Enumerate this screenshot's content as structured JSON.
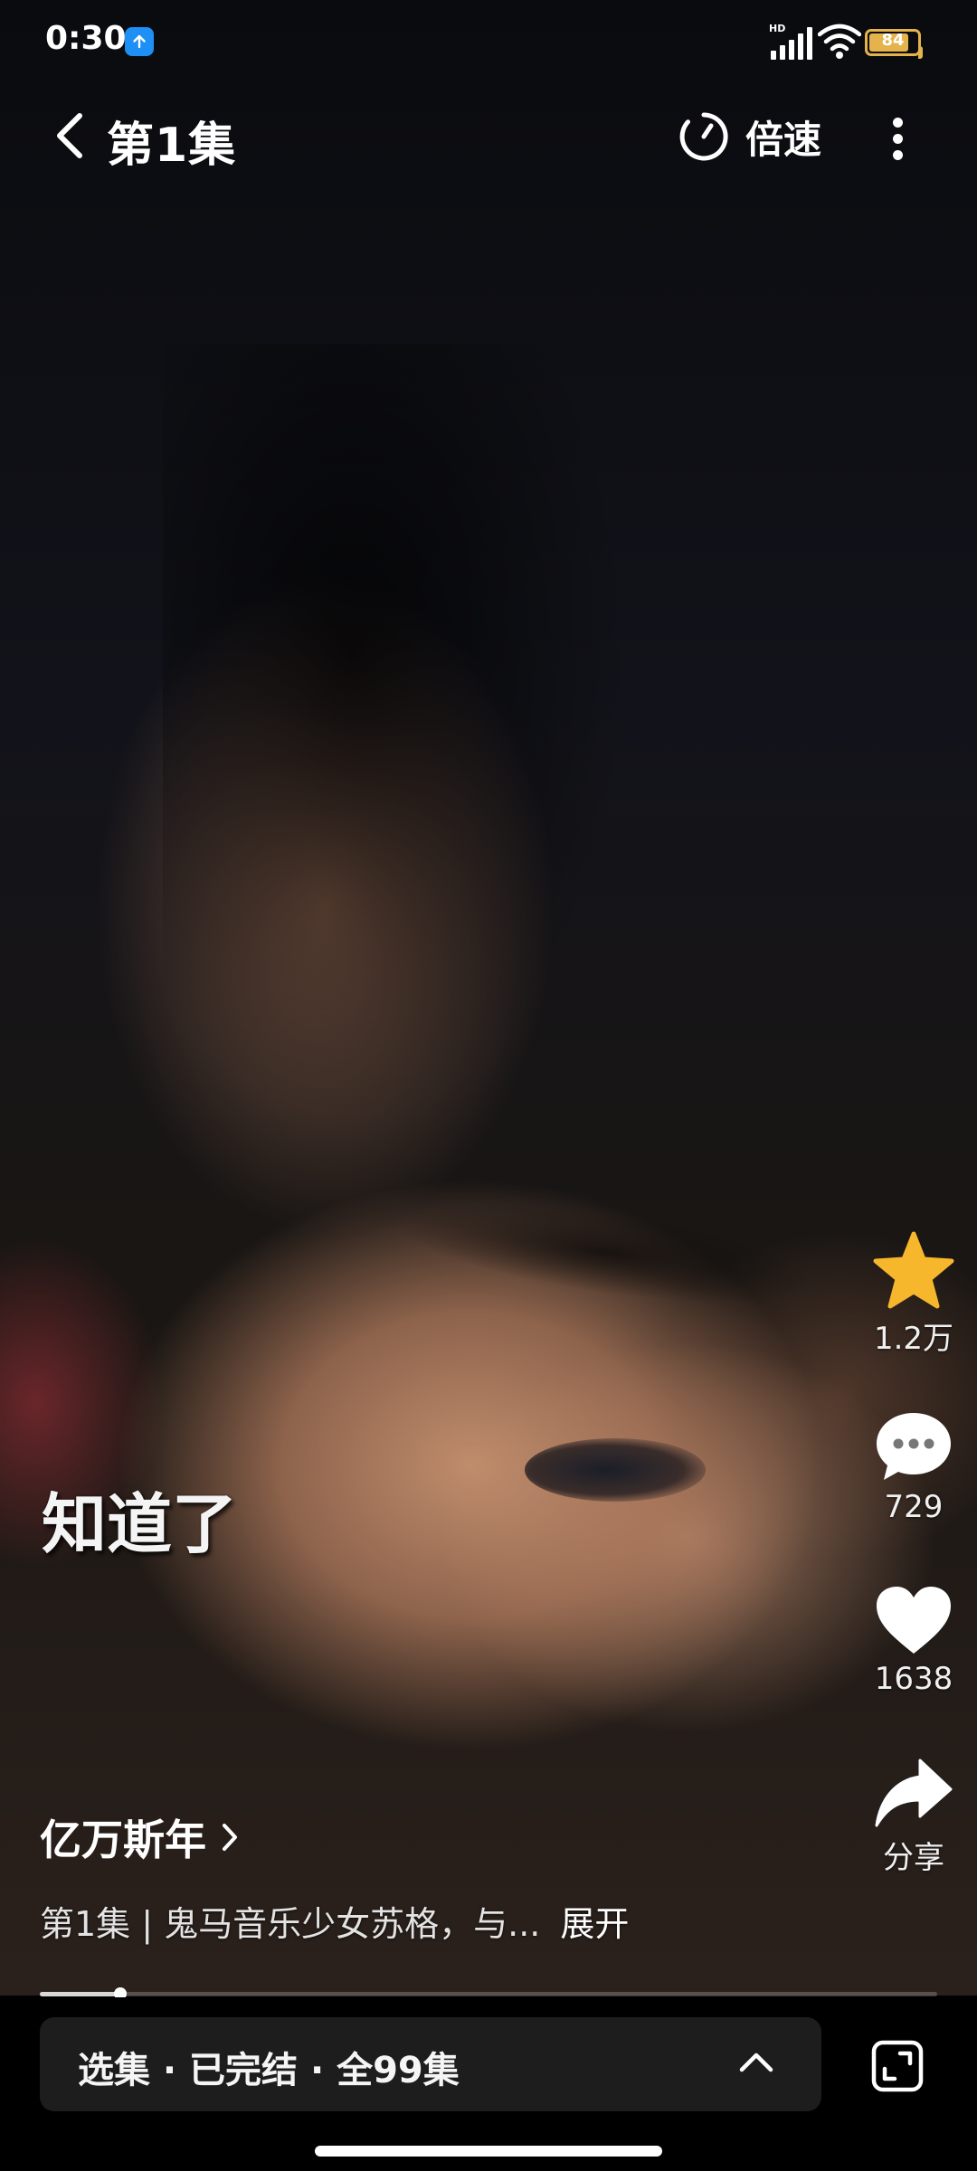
{
  "status_bar": {
    "time": "0:30",
    "network_label": "HD",
    "battery_level": "84",
    "battery_fraction": 0.84,
    "accent_color": "#1e8ff5",
    "battery_color": "#e4b34b"
  },
  "top_nav": {
    "back_icon": "chevron-left-icon",
    "title": "第1集",
    "speed_icon": "timer-icon",
    "speed_label": "倍速",
    "more_icon": "more-vertical-icon"
  },
  "video": {
    "subtitle": "知道了",
    "progress_fraction": 0.09
  },
  "actions": {
    "favorite": {
      "icon": "star-icon",
      "count": "1.2万",
      "color": "#f6b72c"
    },
    "comment": {
      "icon": "comment-icon",
      "count": "729"
    },
    "like": {
      "icon": "heart-icon",
      "count": "1638"
    },
    "share": {
      "icon": "share-icon",
      "label": "分享"
    }
  },
  "drama": {
    "title": "亿万斯年",
    "description": "第1集 | 鬼马音乐少女苏格，与...",
    "expand_label": "展开"
  },
  "bottom_bar": {
    "episode_selector_label": "选集 · 已完结 · 全99集",
    "expand_icon": "chevron-up-icon",
    "fullscreen_icon": "fullscreen-icon"
  }
}
